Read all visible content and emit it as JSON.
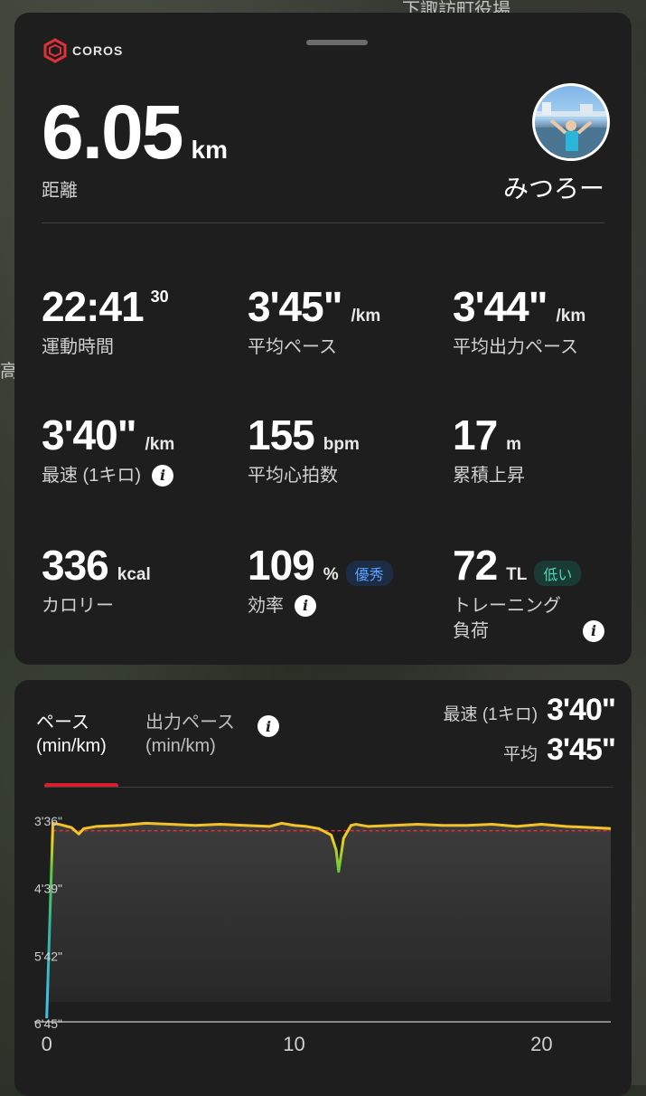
{
  "map": {
    "label_top": "下諏訪町役場",
    "label_left": "高"
  },
  "brand": "COROS",
  "distance": {
    "value": "6.05",
    "unit": "km",
    "label": "距離"
  },
  "user": {
    "name": "みつろー"
  },
  "stats": [
    {
      "value": "22:41",
      "sup": "30",
      "unit": "",
      "label": "運動時間"
    },
    {
      "value": "3'45\"",
      "unit": "/km",
      "label": "平均ペース"
    },
    {
      "value": "3'44\"",
      "unit": "/km",
      "label": "平均出力ペース"
    },
    {
      "value": "3'40\"",
      "unit": "/km",
      "label": "最速 (1キロ)",
      "info": true
    },
    {
      "value": "155",
      "unit": "bpm",
      "label": "平均心拍数"
    },
    {
      "value": "17",
      "unit": "m",
      "label": "累積上昇"
    },
    {
      "value": "336",
      "unit": "kcal",
      "label": "カロリー"
    },
    {
      "value": "109",
      "unit": "%",
      "badge": "優秀",
      "label": "効率",
      "info": true
    },
    {
      "value": "72",
      "unit": "TL",
      "badge": "低い",
      "label": "トレーニング\n負荷",
      "info": true
    }
  ],
  "tabs": [
    {
      "label": "ペース",
      "sublabel": "(min/km)"
    },
    {
      "label": "出力ペース",
      "sublabel": "(min/km)"
    }
  ],
  "summary": [
    {
      "label": "最速 (1キロ)",
      "value": "3'40\""
    },
    {
      "label": "平均",
      "value": "3'45\""
    }
  ],
  "colors": {
    "accent": "#d91f2e",
    "pace_line": "#f5b731",
    "avg_line": "#e0303a"
  },
  "chart_data": {
    "type": "area",
    "y_ticks": [
      "3'36\"",
      "4'39\"",
      "5'42\"",
      "6'45\""
    ],
    "x_ticks": [
      "0",
      "10",
      "20"
    ],
    "xlim": [
      -0.5,
      22.8
    ],
    "ylim_seconds": [
      216,
      405
    ],
    "average_seconds": 225,
    "x": [
      0,
      0.25,
      0.5,
      1,
      1.3,
      1.5,
      2,
      3,
      4,
      5,
      6,
      7,
      8,
      9,
      9.5,
      10,
      10.5,
      11,
      11.5,
      11.7,
      11.8,
      12,
      12.3,
      12.5,
      13,
      14,
      15,
      16,
      17,
      18,
      19,
      20,
      21,
      22,
      22.8
    ],
    "y_seconds": [
      400,
      218,
      219,
      222,
      228,
      223,
      221,
      220,
      218,
      219,
      220,
      219,
      220,
      221,
      218,
      220,
      221,
      223,
      229,
      243,
      263,
      232,
      220,
      219,
      221,
      220,
      219,
      220,
      220,
      219,
      221,
      219,
      221,
      222,
      223
    ]
  }
}
